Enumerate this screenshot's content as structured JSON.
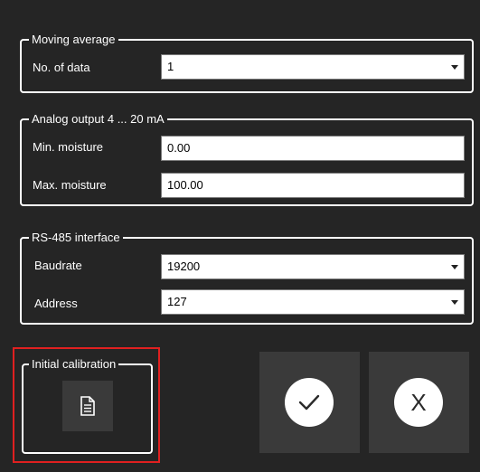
{
  "moving_average": {
    "title": "Moving average",
    "no_of_data_label": "No. of data",
    "no_of_data_value": "1"
  },
  "analog_output": {
    "title": "Analog output 4 ... 20 mA",
    "min_label": "Min. moisture",
    "min_value": "0.00",
    "max_label": "Max. moisture",
    "max_value": "100.00"
  },
  "rs485": {
    "title": "RS-485 interface",
    "baudrate_label": "Baudrate",
    "baudrate_value": "19200",
    "address_label": "Address",
    "address_value": "127"
  },
  "initial_calibration": {
    "title": "Initial calibration",
    "icon": "document-icon"
  },
  "actions": {
    "confirm_icon": "checkmark-icon",
    "cancel_label": "X"
  },
  "colors": {
    "background": "#252525",
    "tile": "#3a3a3a",
    "highlight": "#e02020"
  }
}
